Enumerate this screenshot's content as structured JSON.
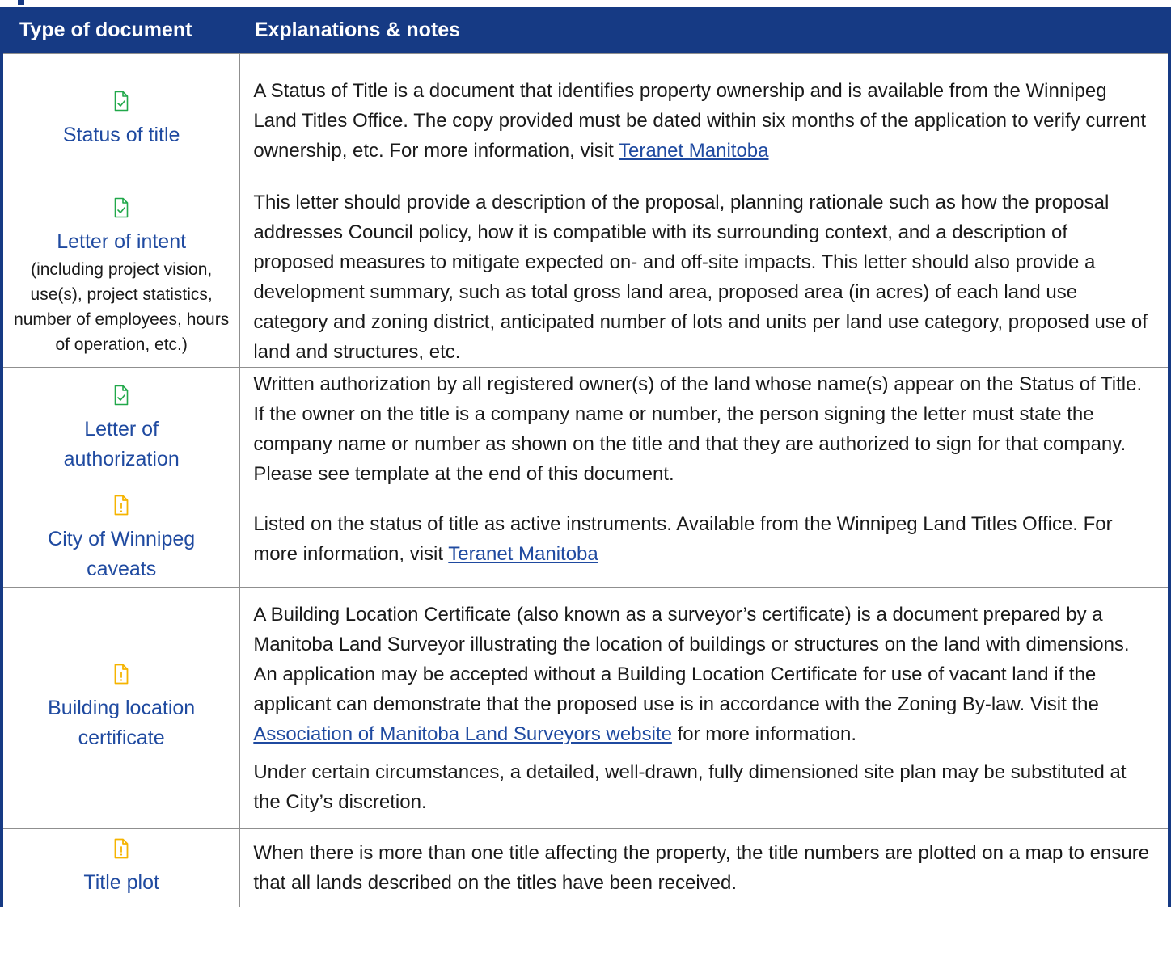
{
  "table": {
    "header": {
      "col1": "Type of document",
      "col2": "Explanations & notes"
    },
    "rows": [
      {
        "icon": "document-check-icon",
        "icon_color": "#21a84a",
        "type": "Status of title",
        "sub": "",
        "notes_pre": "A Status of Title is a document that identifies property ownership and is available from the Winnipeg Land Titles Office. The copy provided must be dated within six months of the application to verify current ownership, etc. For more information, visit ",
        "link": "Teranet Manitoba",
        "notes_post": ""
      },
      {
        "icon": "document-check-icon",
        "icon_color": "#21a84a",
        "type": "Letter of intent",
        "sub": "(including project vision, use(s), project statistics, number of employees, hours of operation, etc.)",
        "notes": "This letter should provide a description of the proposal, planning rationale such as how the proposal addresses Council policy, how it is compatible with its surrounding context, and a description of proposed measures to mitigate expected on- and off-site impacts. This letter should also provide a development summary, such as total gross land area, proposed area (in acres) of each land use category and zoning district, anticipated number of lots and units per land use category, proposed use of land and structures, etc."
      },
      {
        "icon": "document-check-icon",
        "icon_color": "#21a84a",
        "type": "Letter of authorization",
        "sub": "",
        "notes": "Written authorization by all registered owner(s) of the land whose name(s) appear on the Status of Title. If the owner on the title is a company name or number, the person signing the letter must state the company name or number as shown on the title and that they are authorized to sign for that company. Please see template at the end of this document."
      },
      {
        "icon": "document-alert-icon",
        "icon_color": "#f5b400",
        "type": "City of Winnipeg caveats",
        "sub": "",
        "notes_pre": "Listed on the status of title as active instruments. Available from the Winnipeg Land Titles Office. For more information, visit ",
        "link": "Teranet Manitoba",
        "notes_post": ""
      },
      {
        "icon": "document-alert-icon",
        "icon_color": "#f5b400",
        "type": "Building location certificate",
        "sub": "",
        "notes_pre": "A Building Location Certificate (also known as a surveyor’s certificate) is a document prepared by a Manitoba Land Surveyor illustrating the location of buildings or structures on the land with dimensions. An application may be accepted without a Building Location Certificate for use of vacant land if the applicant can demonstrate that the proposed use is in accordance with the Zoning By-law. Visit the ",
        "link": "Association of Manitoba Land Surveyors website",
        "notes_post": " for more information.",
        "notes_2": "Under certain circumstances, a detailed, well-drawn, fully dimensioned site plan may be substituted at the City’s discretion."
      },
      {
        "icon": "document-alert-icon",
        "icon_color": "#f5b400",
        "type": "Title plot",
        "sub": "",
        "notes": "When there is more than one title affecting the property, the title numbers are plotted on a map to ensure that all lands described on the titles have been received."
      }
    ]
  },
  "colors": {
    "header_bg": "#163a84",
    "type_text": "#1f4aa0",
    "link": "#1f4aa0"
  }
}
